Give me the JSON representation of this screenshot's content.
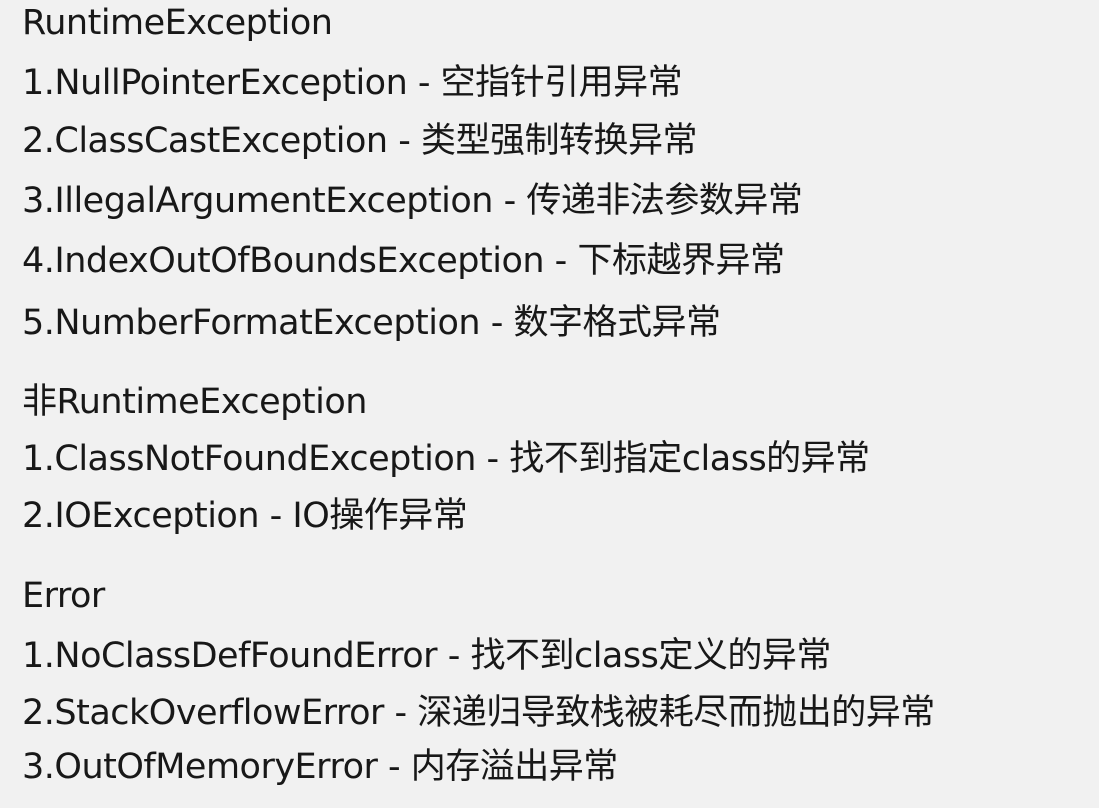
{
  "sections": [
    {
      "heading": "RuntimeException",
      "items": [
        "1.NullPointerException - 空指针引用异常",
        "2.ClassCastException - 类型强制转换异常",
        "3.IllegalArgumentException - 传递非法参数异常",
        "4.IndexOutOfBoundsException - 下标越界异常",
        "5.NumberFormatException - 数字格式异常"
      ]
    },
    {
      "heading": "非RuntimeException",
      "items": [
        "1.ClassNotFoundException - 找不到指定class的异常",
        "2.IOException - IO操作异常"
      ]
    },
    {
      "heading": "Error",
      "items": [
        "1.NoClassDefFoundError - 找不到class定义的异常",
        "2.StackOverflowError - 深递归导致栈被耗尽而抛出的异常",
        "3.OutOfMemoryError - 内存溢出异常"
      ]
    }
  ]
}
